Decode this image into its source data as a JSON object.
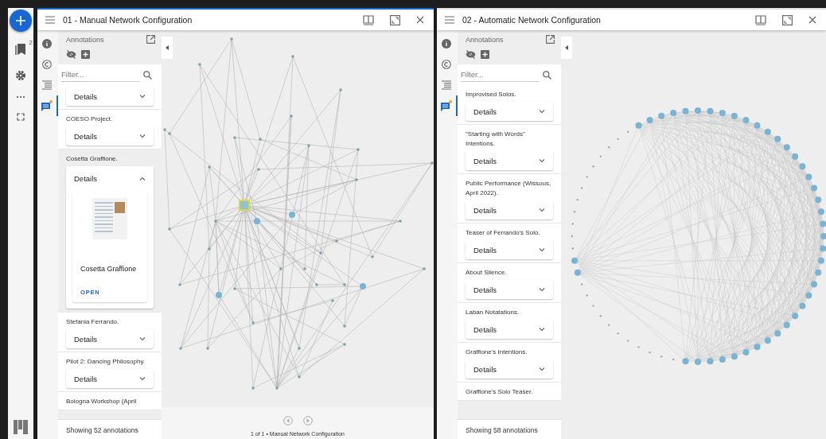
{
  "rail": {
    "bookmark_count": "2"
  },
  "windows": [
    {
      "title": "01 - Manual Network Configuration",
      "focused": true,
      "panel_tabs": [
        {
          "kind": "info",
          "selected": false
        },
        {
          "kind": "rights",
          "selected": false
        },
        {
          "kind": "contents",
          "selected": false
        },
        {
          "kind": "annotations",
          "selected": true
        }
      ],
      "panel_title": "Annotations",
      "filter_placeholder": "Filter...",
      "items": [
        {
          "details": "Details",
          "selected": false,
          "expanded": false
        },
        {
          "label": "COESO Project.",
          "details": "Details",
          "selected": false,
          "expanded": false
        },
        {
          "label": "Cosetta Graffione.",
          "details": "Details",
          "selected": true,
          "expanded": true,
          "card": {
            "title": "Cosetta Graffione",
            "action": "OPEN"
          }
        },
        {
          "label": "Stefania Ferrando.",
          "details": "Details",
          "selected": false,
          "expanded": false
        },
        {
          "label": "Pilot 2: Dancing Philosophy.",
          "details": "Details",
          "selected": false,
          "expanded": false
        },
        {
          "label": "Bologna Workshop (April",
          "selected": false
        }
      ],
      "footer": "Showing 52 annotations",
      "canvas": {
        "kind": "force",
        "caption": "1 of 1 • Manual Network Configuration"
      }
    },
    {
      "title": "02 - Automatic Network Configuration",
      "focused": false,
      "panel_tabs": [
        {
          "kind": "info",
          "selected": false
        },
        {
          "kind": "rights",
          "selected": false
        },
        {
          "kind": "contents",
          "selected": false
        },
        {
          "kind": "annotations",
          "selected": true
        }
      ],
      "panel_title": "Annotations",
      "filter_placeholder": "Filter...",
      "items": [
        {
          "label": "Improvised Solos.",
          "details": "Details",
          "selected": false,
          "expanded": false
        },
        {
          "label": "\"Starting with Words\" Intentions.",
          "details": "Details",
          "selected": false,
          "expanded": false
        },
        {
          "label": "Public Performance (Wissous, April 2022).",
          "details": "Details",
          "selected": false,
          "expanded": false
        },
        {
          "label": "Teaser of Ferrando's Solo.",
          "details": "Details",
          "selected": false,
          "expanded": false
        },
        {
          "label": "About Silence.",
          "details": "Details",
          "selected": false,
          "expanded": false
        },
        {
          "label": "Laban Notatations.",
          "details": "Details",
          "selected": false,
          "expanded": false
        },
        {
          "label": "Graffione's Intentions.",
          "details": "Details",
          "selected": false,
          "expanded": false
        },
        {
          "label": "Graffione's Solo Teaser.",
          "selected": false
        }
      ],
      "footer": "Showing 58 annotations",
      "canvas": {
        "kind": "circle"
      }
    }
  ]
}
